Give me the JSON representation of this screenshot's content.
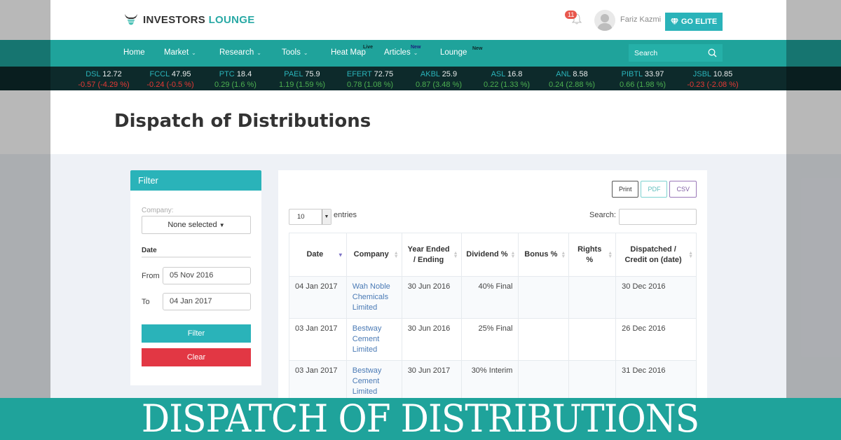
{
  "header": {
    "logo_word_1": "INVESTORS",
    "logo_word_2": "LOUNGE",
    "notification_count": "11",
    "username": "Fariz Kazmi",
    "go_elite_label": "GO ELITE"
  },
  "nav": {
    "items": [
      {
        "label": "Home",
        "dropdown": false
      },
      {
        "label": "Market",
        "dropdown": true
      },
      {
        "label": "Research",
        "dropdown": true
      },
      {
        "label": "Tools",
        "dropdown": true
      },
      {
        "label": "Heat Map",
        "dropdown": false,
        "badge": "Live"
      },
      {
        "label": "Articles",
        "dropdown": true,
        "badge": "New"
      },
      {
        "label": "Lounge",
        "dropdown": false,
        "badge": "New"
      }
    ],
    "search_placeholder": "Search"
  },
  "ticker": [
    {
      "symbol": "DSL",
      "price": "12.72",
      "change": "-0.57 (-4.29 %)",
      "direction": "down"
    },
    {
      "symbol": "FCCL",
      "price": "47.95",
      "change": "-0.24 (-0.5 %)",
      "direction": "down"
    },
    {
      "symbol": "PTC",
      "price": "18.4",
      "change": "0.29 (1.6 %)",
      "direction": "up"
    },
    {
      "symbol": "PAEL",
      "price": "75.9",
      "change": "1.19 (1.59 %)",
      "direction": "up"
    },
    {
      "symbol": "EFERT",
      "price": "72.75",
      "change": "0.78 (1.08 %)",
      "direction": "up"
    },
    {
      "symbol": "AKBL",
      "price": "25.9",
      "change": "0.87 (3.48 %)",
      "direction": "up"
    },
    {
      "symbol": "ASL",
      "price": "16.8",
      "change": "0.22 (1.33 %)",
      "direction": "up"
    },
    {
      "symbol": "ANL",
      "price": "8.58",
      "change": "0.24 (2.88 %)",
      "direction": "up"
    },
    {
      "symbol": "PIBTL",
      "price": "33.97",
      "change": "0.66 (1.98 %)",
      "direction": "up"
    },
    {
      "symbol": "JSBL",
      "price": "10.85",
      "change": "-0.23 (-2.08 %)",
      "direction": "down"
    }
  ],
  "page": {
    "title": "Dispatch of Distributions"
  },
  "filter": {
    "heading": "Filter",
    "company_label": "Company:",
    "company_value": "None selected",
    "date_heading": "Date",
    "from_label": "From",
    "from_value": "05 Nov 2016",
    "to_label": "To",
    "to_value": "04 Jan 2017",
    "filter_button": "Filter",
    "clear_button": "Clear"
  },
  "table": {
    "tools": {
      "print": "Print",
      "pdf": "PDF",
      "csv": "CSV"
    },
    "page_length": "10",
    "entries_label": "entries",
    "search_label": "Search:",
    "search_value": "",
    "columns": [
      {
        "label": "Date",
        "sort": "desc"
      },
      {
        "label": "Company",
        "sort": "none"
      },
      {
        "label": "Year Ended / Ending",
        "sort": "none"
      },
      {
        "label": "Dividend %",
        "sort": "none"
      },
      {
        "label": "Bonus %",
        "sort": "none"
      },
      {
        "label": "Rights %",
        "sort": "none"
      },
      {
        "label": "Dispatched / Credit on (date)",
        "sort": "none"
      }
    ],
    "rows": [
      {
        "date": "04 Jan 2017",
        "company": "Wah Noble Chemicals Limited",
        "year_end": "30 Jun 2016",
        "dividend": "40% Final",
        "bonus": "",
        "rights": "",
        "dispatched": "30 Dec 2016"
      },
      {
        "date": "03 Jan 2017",
        "company": "Bestway Cement Limited",
        "year_end": "30 Jun 2016",
        "dividend": "25% Final",
        "bonus": "",
        "rights": "",
        "dispatched": "26 Dec 2016"
      },
      {
        "date": "03 Jan 2017",
        "company": "Bestway Cement Limited",
        "year_end": "30 Jun 2017",
        "dividend": "30% Interim",
        "bonus": "",
        "rights": "",
        "dispatched": "31 Dec 2016"
      }
    ]
  },
  "banner": {
    "text": "DISPATCH OF DISTRIBUTIONS"
  },
  "colors": {
    "brand_teal": "#1fa39b",
    "button_teal": "#2ab3b9",
    "danger_red": "#e23744",
    "ticker_bg": "#0d2a2b",
    "up_green": "#4caf50",
    "down_red": "#e53935",
    "link_blue": "#4a7ab5"
  }
}
